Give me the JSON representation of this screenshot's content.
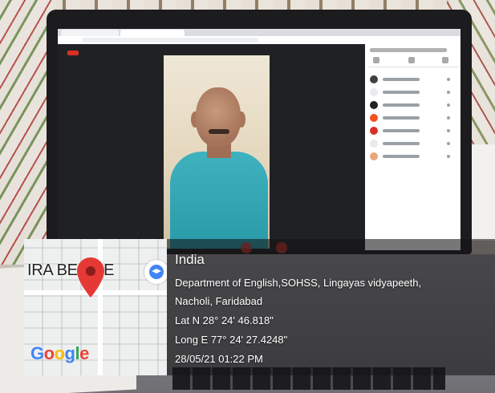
{
  "map": {
    "place_label": "IRA BE        AGE",
    "logo_text": "Google",
    "logo_letters": [
      {
        "ch": "G",
        "color": "#4285F4"
      },
      {
        "ch": "o",
        "color": "#EA4335"
      },
      {
        "ch": "o",
        "color": "#FBBC05"
      },
      {
        "ch": "g",
        "color": "#4285F4"
      },
      {
        "ch": "l",
        "color": "#34A853"
      },
      {
        "ch": "e",
        "color": "#EA4335"
      }
    ],
    "pin_color": "#E53935"
  },
  "geotag": {
    "country": "India",
    "address_line1": "Department of English,SOHSS, Lingayas vidyapeeth,",
    "address_line2": "Nacholi, Faridabad",
    "latitude": "Lat N 28° 24' 46.818\"",
    "longitude": "Long E 77° 24' 27.4248\"",
    "datetime": "28/05/21 01:22 PM"
  },
  "meeting": {
    "accent_color": "#d93025",
    "participant_avatar_colors": [
      "#3c4043",
      "#e8eaed",
      "#202124",
      "#f4511e",
      "#d93025",
      "#e8eaed",
      "#e8a87c"
    ]
  }
}
